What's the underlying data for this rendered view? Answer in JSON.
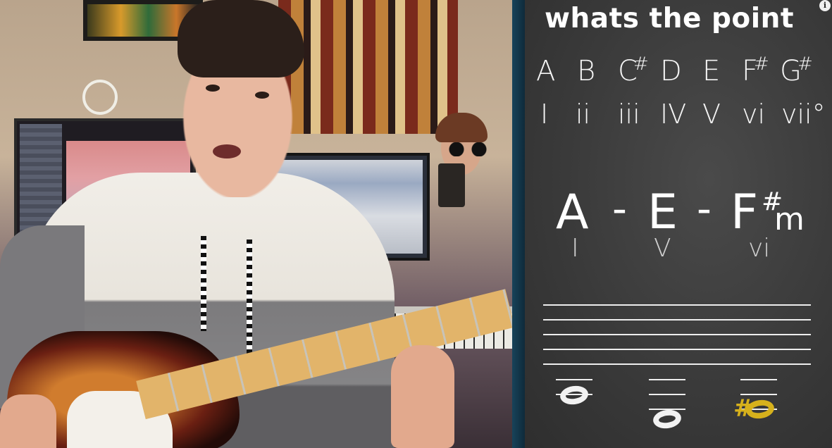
{
  "board": {
    "title": "whats the point",
    "info_icon": "i",
    "notes": [
      {
        "letter": "A",
        "sharp": ""
      },
      {
        "letter": "B",
        "sharp": ""
      },
      {
        "letter": "C",
        "sharp": "#"
      },
      {
        "letter": "D",
        "sharp": ""
      },
      {
        "letter": "E",
        "sharp": ""
      },
      {
        "letter": "F",
        "sharp": "#"
      },
      {
        "letter": "G",
        "sharp": "#"
      }
    ],
    "numerals": [
      "I",
      "ii",
      "iii",
      "IV",
      "V",
      "vi",
      "vii°"
    ],
    "progression": {
      "chords": [
        {
          "root": "A",
          "sharp": "",
          "suffix": ""
        },
        {
          "root": "E",
          "sharp": "",
          "suffix": ""
        },
        {
          "root": "F",
          "sharp": "#",
          "suffix": "m"
        }
      ],
      "separator": "-",
      "numerals": [
        "I",
        "V",
        "vi"
      ]
    },
    "staff": {
      "highlight_color": "#d6b11c",
      "sharp_symbol": "#"
    }
  },
  "colors": {
    "board_bg": "#3a3a3a",
    "divider": "#17435a",
    "highlight": "#d6b11c"
  }
}
